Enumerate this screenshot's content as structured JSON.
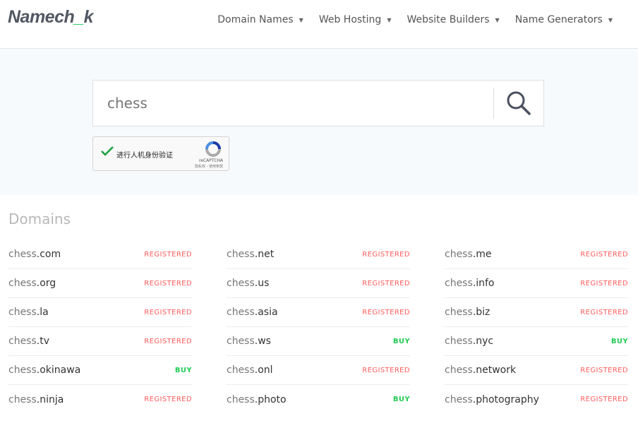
{
  "logo": {
    "text": "Namech",
    "underscore": "_",
    "end": "k"
  },
  "nav": [
    {
      "label": "Domain Names"
    },
    {
      "label": "Web Hosting"
    },
    {
      "label": "Website Builders"
    },
    {
      "label": "Name Generators"
    }
  ],
  "search": {
    "value": "chess",
    "icon": "search-icon"
  },
  "captcha": {
    "label": "进行人机身份验证",
    "brand": "reCAPTCHA",
    "terms": "隐私权 - 使用条款",
    "checked": true
  },
  "domains_title": "Domains",
  "colors": {
    "registered": "#ff5c5c",
    "buy": "#22cc55",
    "accent": "#22cc66"
  },
  "columns": [
    [
      {
        "base": "chess",
        "tld": ".com",
        "status": "REGISTERED"
      },
      {
        "base": "chess",
        "tld": ".org",
        "status": "REGISTERED"
      },
      {
        "base": "chess",
        "tld": ".la",
        "status": "REGISTERED"
      },
      {
        "base": "chess",
        "tld": ".tv",
        "status": "REGISTERED"
      },
      {
        "base": "chess",
        "tld": ".okinawa",
        "status": "BUY"
      },
      {
        "base": "chess",
        "tld": ".ninja",
        "status": "REGISTERED"
      }
    ],
    [
      {
        "base": "chess",
        "tld": ".net",
        "status": "REGISTERED"
      },
      {
        "base": "chess",
        "tld": ".us",
        "status": "REGISTERED"
      },
      {
        "base": "chess",
        "tld": ".asia",
        "status": "REGISTERED"
      },
      {
        "base": "chess",
        "tld": ".ws",
        "status": "BUY"
      },
      {
        "base": "chess",
        "tld": ".onl",
        "status": "REGISTERED"
      },
      {
        "base": "chess",
        "tld": ".photo",
        "status": "BUY"
      }
    ],
    [
      {
        "base": "chess",
        "tld": ".me",
        "status": "REGISTERED"
      },
      {
        "base": "chess",
        "tld": ".info",
        "status": "REGISTERED"
      },
      {
        "base": "chess",
        "tld": ".biz",
        "status": "REGISTERED"
      },
      {
        "base": "chess",
        "tld": ".nyc",
        "status": "BUY"
      },
      {
        "base": "chess",
        "tld": ".network",
        "status": "REGISTERED"
      },
      {
        "base": "chess",
        "tld": ".photography",
        "status": "REGISTERED"
      }
    ]
  ]
}
